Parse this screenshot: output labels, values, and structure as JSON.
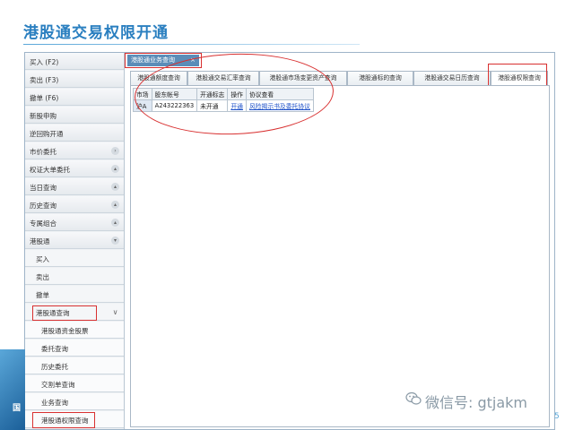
{
  "slide": {
    "title": "港股通交易权限开通",
    "page_number": "5",
    "wechat_label": "微信号: gtjakm",
    "logo_text": "国"
  },
  "sidebar": {
    "items": [
      {
        "label": "买入 (F2)",
        "arrow": ""
      },
      {
        "label": "卖出 (F3)",
        "arrow": ""
      },
      {
        "label": "撤单 (F6)",
        "arrow": ""
      },
      {
        "label": "新股申购",
        "arrow": ""
      },
      {
        "label": "逆回购开通",
        "arrow": ""
      },
      {
        "label": "市价委托",
        "arrow": "›"
      },
      {
        "label": "权证大单委托",
        "arrow": "▴"
      },
      {
        "label": "当日查询",
        "arrow": "▴"
      },
      {
        "label": "历史查询",
        "arrow": "▴"
      },
      {
        "label": "专属组合",
        "arrow": "▴"
      },
      {
        "label": "港股通",
        "arrow": "▾"
      }
    ],
    "hk_sub": [
      {
        "label": "买入"
      },
      {
        "label": "卖出"
      },
      {
        "label": "撤单"
      }
    ],
    "hk_query": {
      "label": "港股通查询",
      "arrow": "∨"
    },
    "hk_query_items": [
      {
        "label": "港股通资金股票"
      },
      {
        "label": "委托查询"
      },
      {
        "label": "历史委托"
      },
      {
        "label": "交割单查询"
      },
      {
        "label": "业务查询"
      },
      {
        "label": "港股通权限查询"
      }
    ]
  },
  "main": {
    "active_tab": "港股通业务查询",
    "close_glyph": "×",
    "sub_tabs": [
      "港股通额度查询",
      "港股通交易汇率查询",
      "港股通市场变更资产查询",
      "港股通标的查询",
      "港股通交易日历查询",
      "港股通权限查询"
    ],
    "table": {
      "headers": [
        "市场",
        "股东帐号",
        "开通标志",
        "操作",
        "协议查看"
      ],
      "rows": [
        [
          "沪A",
          "A243222363",
          "未开通",
          "开通",
          "风险揭示书及委托协议"
        ]
      ]
    }
  },
  "colors": {
    "accent": "#2a7fc0",
    "highlight": "#d83030",
    "tab_active": "#5b8db8",
    "link": "#1a4ec8"
  }
}
